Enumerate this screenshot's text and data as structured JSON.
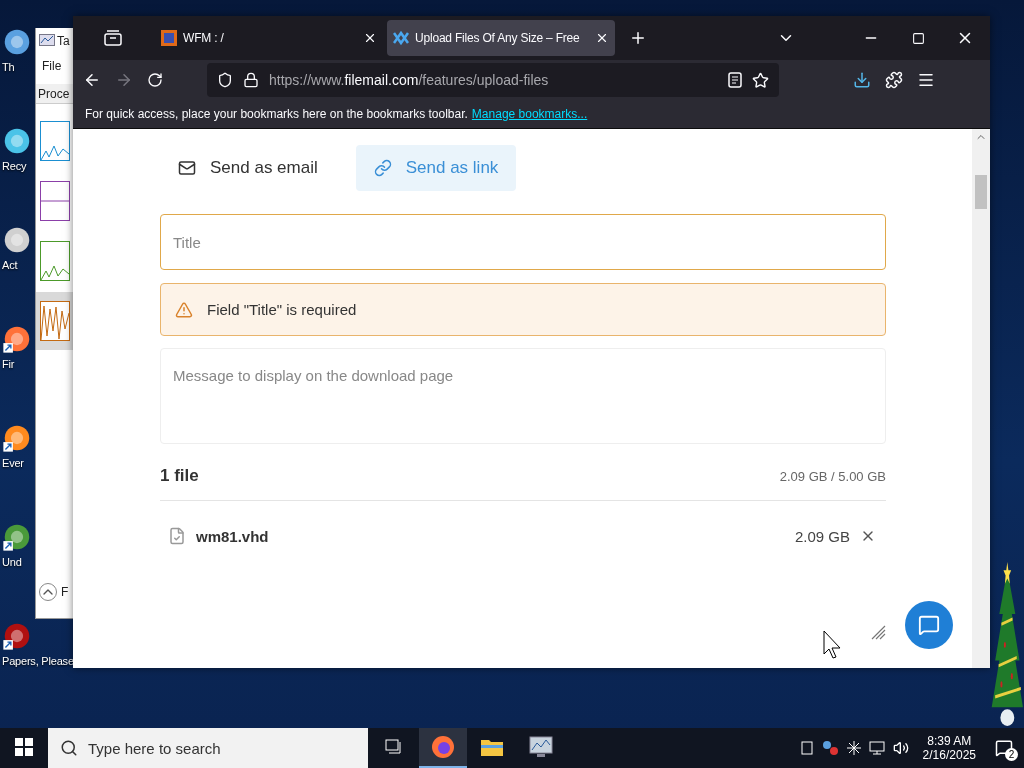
{
  "desktop_icons": [
    {
      "label": "Th",
      "shortcut": false
    },
    {
      "label": "Recy",
      "shortcut": false
    },
    {
      "label": "Act",
      "shortcut": false
    },
    {
      "label": "Fir",
      "shortcut": true
    },
    {
      "label": "Ever",
      "shortcut": true
    },
    {
      "label": "Und",
      "shortcut": true
    },
    {
      "label": "Papers, Please",
      "shortcut": true
    }
  ],
  "task_manager": {
    "title": "Ta",
    "menu": "File",
    "tab": "Proce",
    "footer": "F",
    "graphs": [
      {
        "selected": false
      },
      {
        "selected": false
      },
      {
        "selected": false
      },
      {
        "selected": true
      }
    ]
  },
  "browser": {
    "tabs": [
      {
        "title": "WFM : /",
        "selected": false
      },
      {
        "title": "Upload Files Of Any Size – Free",
        "selected": true
      }
    ],
    "url": {
      "prefix": "https://www.",
      "domain": "filemail.com",
      "path": "/features/upload-files"
    },
    "bookmarks_bar": {
      "text": "For quick access, place your bookmarks here on the bookmarks toolbar.",
      "link": "Manage bookmarks..."
    }
  },
  "page": {
    "send_tabs": [
      {
        "label": "Send as email",
        "kind": "email",
        "selected": false
      },
      {
        "label": "Send as link",
        "kind": "link",
        "selected": true
      }
    ],
    "title_field": {
      "placeholder": "Title",
      "error": true
    },
    "alert": "Field \"Title\" is required",
    "message_field": {
      "placeholder": "Message to display on the download page"
    },
    "files_header": "1 file",
    "usage": "2.09 GB / 5.00 GB",
    "files": [
      {
        "name": "wm81.vhd",
        "size": "2.09 GB"
      }
    ]
  },
  "taskbar": {
    "search_placeholder": "Type here to search",
    "apps": [
      {
        "kind": "taskview",
        "active": false
      },
      {
        "kind": "firefox",
        "active": true
      },
      {
        "kind": "explorer",
        "active": false
      },
      {
        "kind": "taskmanager",
        "active": false
      }
    ],
    "time": "8:39 AM",
    "date": "2/16/2025",
    "notifications": "2"
  }
}
